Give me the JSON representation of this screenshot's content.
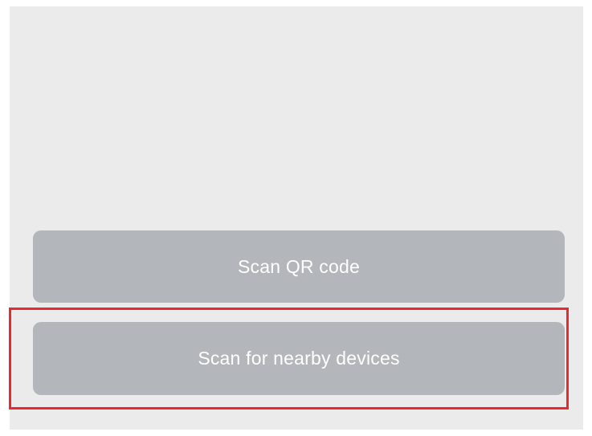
{
  "buttons": {
    "scan_qr_label": "Scan QR code",
    "scan_nearby_label": "Scan for nearby devices"
  },
  "colors": {
    "background": "#ebebeb",
    "button": "#b3b6ba",
    "button_text": "#ffffff",
    "highlight": "#e8292f"
  }
}
